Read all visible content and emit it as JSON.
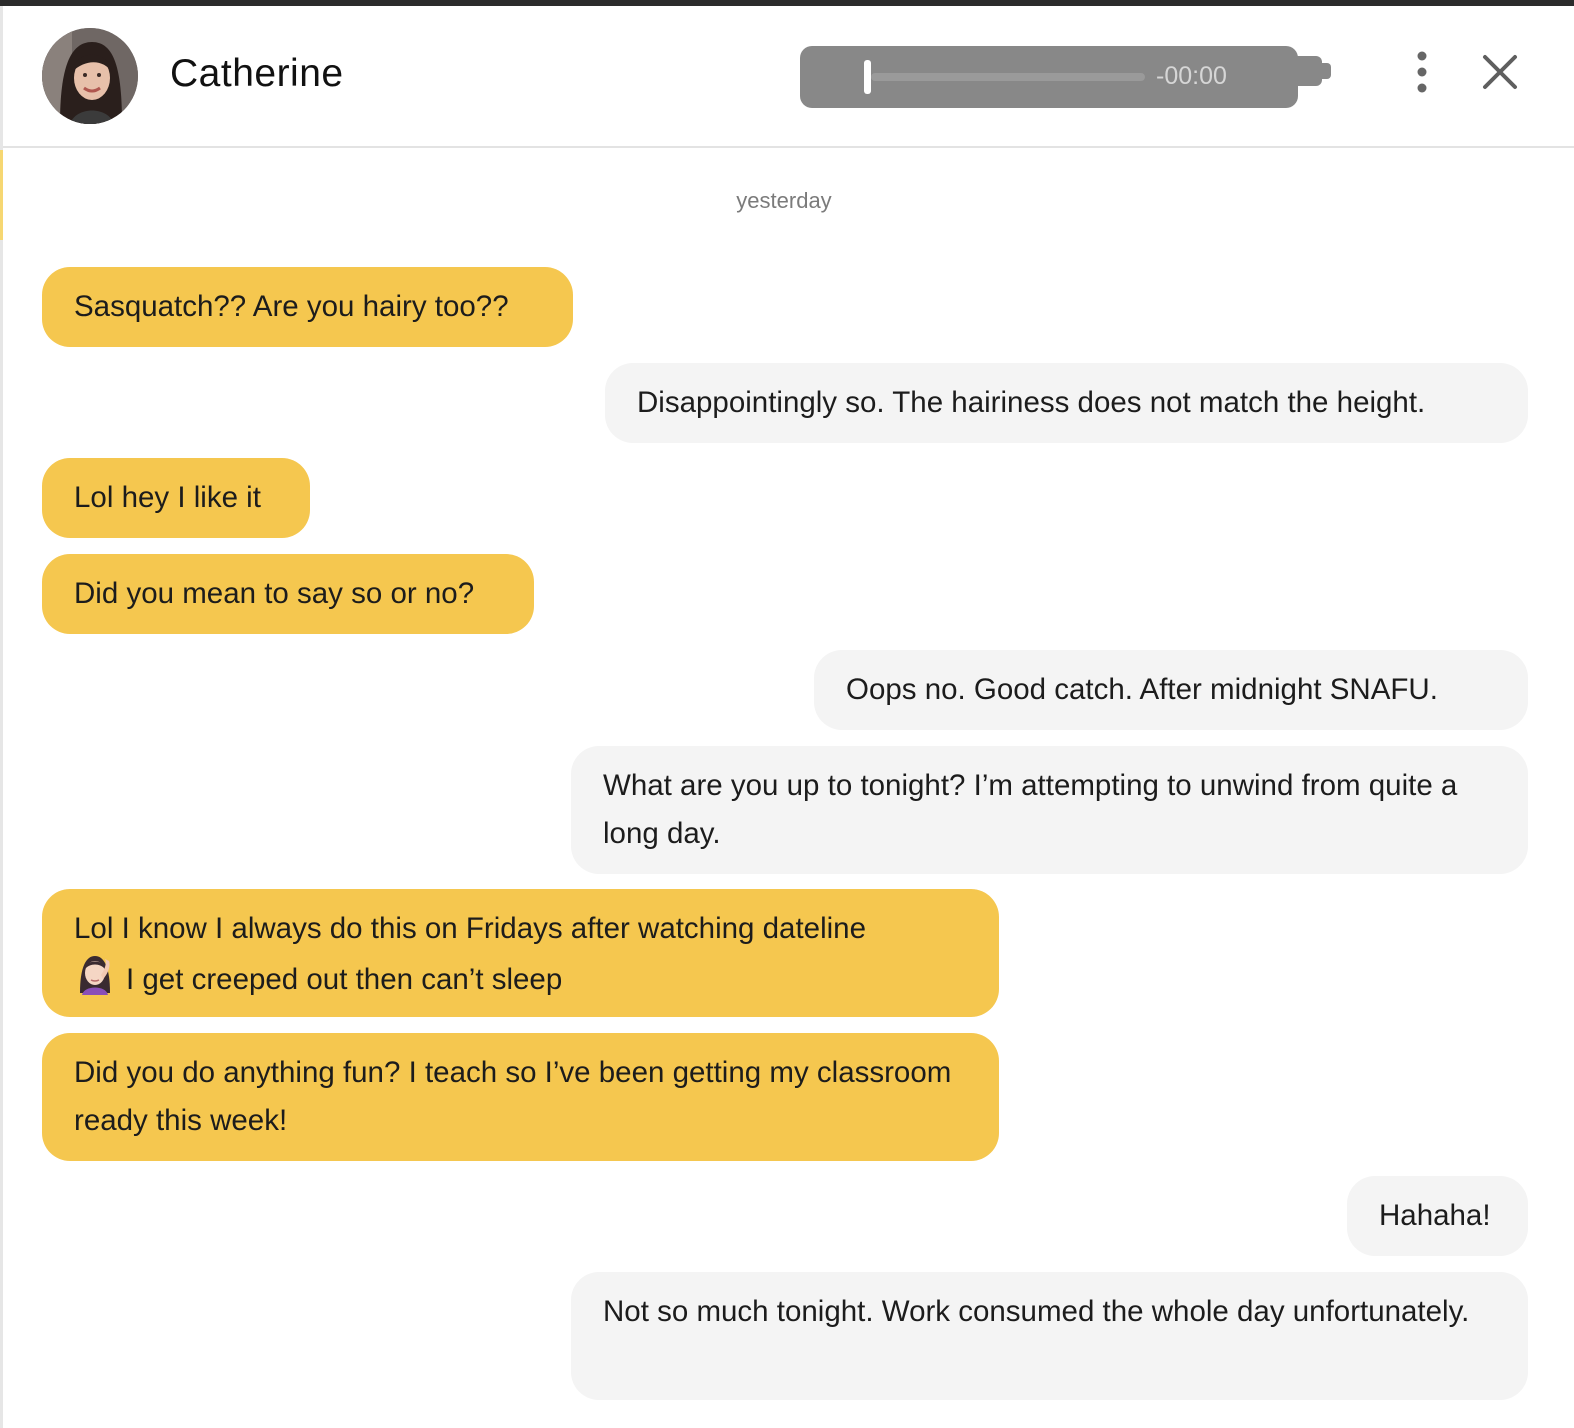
{
  "header": {
    "contact_name": "Catherine",
    "audio_time": "-00:00"
  },
  "icons": {
    "avatar": "avatar",
    "more": "more-vertical-icon",
    "close": "close-icon"
  },
  "colors": {
    "incoming_bubble": "#f5c74f",
    "outgoing_bubble": "#f4f4f4",
    "audio_player": "#888888"
  },
  "chat": {
    "date_separator": "yesterday",
    "messages": [
      {
        "side": "incoming",
        "text": "Sasquatch?? Are you hairy too??"
      },
      {
        "side": "outgoing",
        "text": "Disappointingly so. The hairiness does not match the height."
      },
      {
        "side": "incoming",
        "text": "Lol hey I like it"
      },
      {
        "side": "incoming",
        "text": "Did you mean to say so or no?"
      },
      {
        "side": "outgoing",
        "text": "Oops no. Good catch. After midnight SNAFU."
      },
      {
        "side": "outgoing",
        "text": "What are you up to tonight? I’m attempting to unwind from quite a long day."
      },
      {
        "side": "incoming",
        "text_line1": "Lol I know I always do this on Fridays after watching dateline",
        "emoji": "woman-facepalming-emoji",
        "text_line2": "I get creeped out then can’t sleep"
      },
      {
        "side": "incoming",
        "text": "Did you do anything fun? I teach so I’ve been getting my classroom ready this week!"
      },
      {
        "side": "outgoing",
        "text": "Hahaha!"
      },
      {
        "side": "outgoing",
        "text": "Not so much tonight. Work consumed the whole day unfortunately."
      }
    ]
  }
}
